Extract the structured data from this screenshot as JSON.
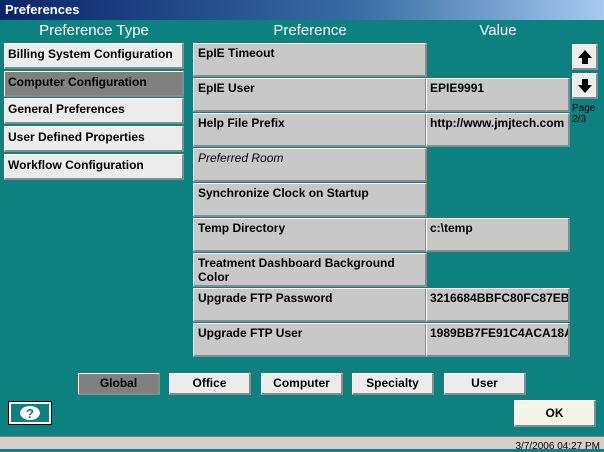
{
  "window": {
    "title": "Preferences"
  },
  "columns": {
    "type": "Preference Type",
    "preference": "Preference",
    "value": "Value"
  },
  "sidebar": {
    "items": [
      {
        "label": "Billing System Configuration",
        "selected": false
      },
      {
        "label": "Computer Configuration",
        "selected": true
      },
      {
        "label": "General Preferences",
        "selected": false
      },
      {
        "label": "User Defined Properties",
        "selected": false
      },
      {
        "label": "Workflow Configuration",
        "selected": false
      }
    ]
  },
  "preferences": [
    {
      "name": "EpIE Timeout",
      "value": ""
    },
    {
      "name": "EpIE User",
      "value": "EPIE9991"
    },
    {
      "name": "Help File Prefix",
      "value": "http://www.jmjtech.com"
    },
    {
      "name": "Preferred Room",
      "value": "",
      "italic": true
    },
    {
      "name": "Synchronize Clock on Startup",
      "value": ""
    },
    {
      "name": "Temp Directory",
      "value": "c:\\temp"
    },
    {
      "name": "Treatment Dashboard Background Color",
      "value": ""
    },
    {
      "name": "Upgrade FTP Password",
      "value": "3216684BBFC80FC87EB"
    },
    {
      "name": "Upgrade FTP User",
      "value": "1989BB7FE91C4ACA18A"
    }
  ],
  "pager": {
    "label": "Page",
    "page": "2/3",
    "up_icon": "arrow-up-icon",
    "down_icon": "arrow-down-icon"
  },
  "scopes": [
    {
      "label": "Global",
      "selected": true
    },
    {
      "label": "Office",
      "selected": false
    },
    {
      "label": "Computer",
      "selected": false
    },
    {
      "label": "Specialty",
      "selected": false
    },
    {
      "label": "User",
      "selected": false
    }
  ],
  "buttons": {
    "ok": "OK",
    "help_icon": "help-icon"
  },
  "statusbar": {
    "datetime": "3/7/2006  04:27 PM"
  },
  "colors": {
    "background": "#0d8080",
    "selected": "#808080",
    "cell": "#c8c8c8"
  }
}
